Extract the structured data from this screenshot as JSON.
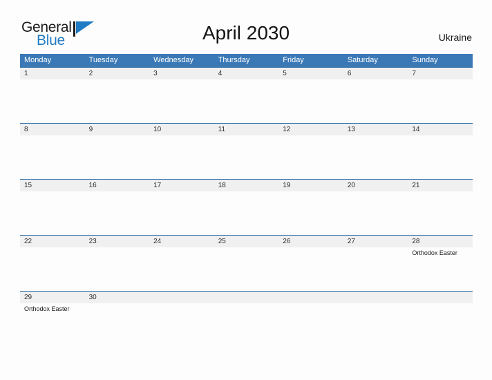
{
  "logo": {
    "word_one": "General",
    "word_two": "Blue",
    "flag_icon": "blue-flag-triangle-icon",
    "blue_hex": "#1f7bc4"
  },
  "header": {
    "title": "April 2030",
    "country": "Ukraine"
  },
  "theme": {
    "header_blue": "#3b79b6",
    "row_rule_blue": "#2e6da4",
    "band_gray": "#f0f0f0",
    "page_background": "#fdfdfd"
  },
  "calendar": {
    "month": "April",
    "year": "2030",
    "week_start": "Monday",
    "day_headers": [
      "Monday",
      "Tuesday",
      "Wednesday",
      "Thursday",
      "Friday",
      "Saturday",
      "Sunday"
    ],
    "weeks": [
      {
        "days": [
          {
            "num": "1",
            "events": []
          },
          {
            "num": "2",
            "events": []
          },
          {
            "num": "3",
            "events": []
          },
          {
            "num": "4",
            "events": []
          },
          {
            "num": "5",
            "events": []
          },
          {
            "num": "6",
            "events": []
          },
          {
            "num": "7",
            "events": []
          }
        ]
      },
      {
        "days": [
          {
            "num": "8",
            "events": []
          },
          {
            "num": "9",
            "events": []
          },
          {
            "num": "10",
            "events": []
          },
          {
            "num": "11",
            "events": []
          },
          {
            "num": "12",
            "events": []
          },
          {
            "num": "13",
            "events": []
          },
          {
            "num": "14",
            "events": []
          }
        ]
      },
      {
        "days": [
          {
            "num": "15",
            "events": []
          },
          {
            "num": "16",
            "events": []
          },
          {
            "num": "17",
            "events": []
          },
          {
            "num": "18",
            "events": []
          },
          {
            "num": "19",
            "events": []
          },
          {
            "num": "20",
            "events": []
          },
          {
            "num": "21",
            "events": []
          }
        ]
      },
      {
        "days": [
          {
            "num": "22",
            "events": []
          },
          {
            "num": "23",
            "events": []
          },
          {
            "num": "24",
            "events": []
          },
          {
            "num": "25",
            "events": []
          },
          {
            "num": "26",
            "events": []
          },
          {
            "num": "27",
            "events": []
          },
          {
            "num": "28",
            "events": [
              "Orthodox Easter"
            ]
          }
        ]
      },
      {
        "days": [
          {
            "num": "29",
            "events": [
              "Orthodox Easter"
            ]
          },
          {
            "num": "30",
            "events": []
          },
          {
            "num": "",
            "events": []
          },
          {
            "num": "",
            "events": []
          },
          {
            "num": "",
            "events": []
          },
          {
            "num": "",
            "events": []
          },
          {
            "num": "",
            "events": []
          }
        ]
      }
    ]
  }
}
